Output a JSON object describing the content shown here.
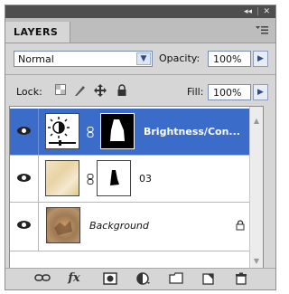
{
  "panel": {
    "collapse_glyph": "◂◂",
    "close_glyph": "✕",
    "tab_label": "LAYERS",
    "menu_icon": "panel-menu-icon"
  },
  "blend": {
    "mode": "Normal",
    "opacity_label": "Opacity:",
    "opacity_value": "100%",
    "lock_label": "Lock:",
    "fill_label": "Fill:",
    "fill_value": "100%"
  },
  "layers": [
    {
      "name": "Brightness/Con...",
      "type": "adjustment",
      "selected": true,
      "visible": true
    },
    {
      "name": "03",
      "type": "image-with-mask",
      "selected": false,
      "visible": true
    },
    {
      "name": "Background",
      "type": "background",
      "selected": false,
      "visible": true,
      "locked": true
    }
  ],
  "toolbar_icons": [
    "link-layers-icon",
    "layer-style-fx-icon",
    "add-mask-icon",
    "adjustment-layer-icon",
    "new-group-icon",
    "new-layer-icon",
    "delete-layer-icon"
  ],
  "fx_label": "fx"
}
